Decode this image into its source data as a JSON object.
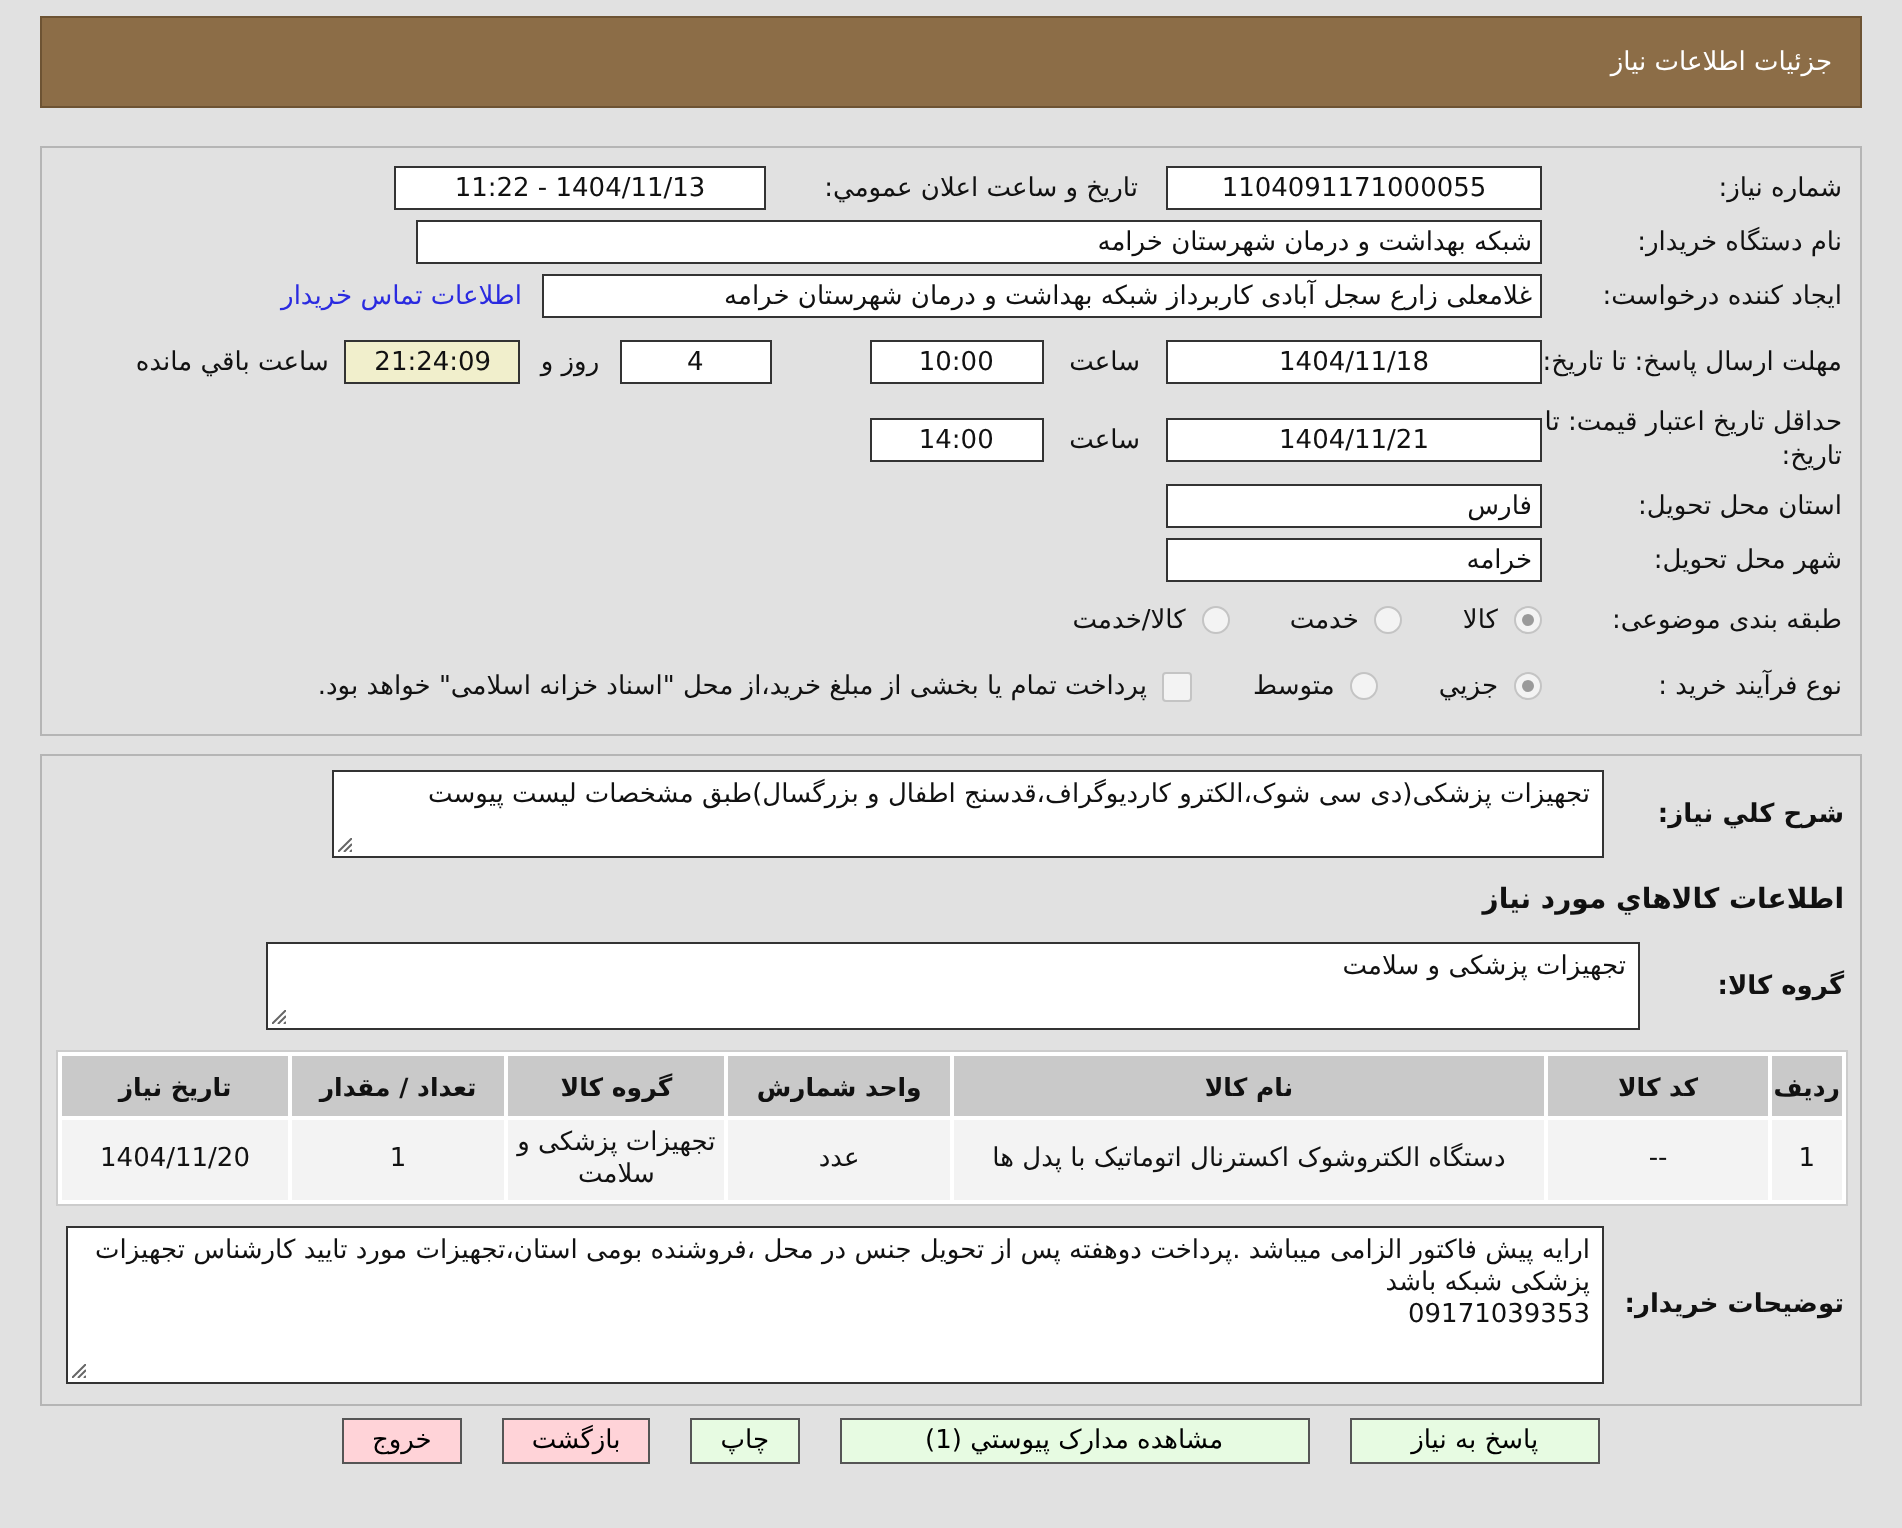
{
  "header": {
    "title": "جزئیات اطلاعات نیاز"
  },
  "summary": {
    "need_number": {
      "label": "شماره نیاز:",
      "value": "1104091171000055"
    },
    "announce": {
      "label": "تاریخ و ساعت اعلان عمومي:",
      "value": "1404/11/13 - 11:22"
    },
    "buyer_org": {
      "label": "نام دستگاه خریدار:",
      "value": "شبکه بهداشت و درمان شهرستان خرامه"
    },
    "requester": {
      "label": "ایجاد کننده درخواست:",
      "value": "غلامعلی زارع سجل آبادی کاربرداز شبکه بهداشت و درمان شهرستان خرامه",
      "link": "اطلاعات تماس خریدار"
    },
    "reply_deadline": {
      "label": "مهلت ارسال پاسخ: تا تاریخ:",
      "date": "1404/11/18",
      "time_label": "ساعت",
      "time": "10:00",
      "days": "4",
      "days_label": "روز و",
      "remaining": "21:24:09",
      "remaining_label": "ساعت باقي مانده"
    },
    "price_validity": {
      "label": "حداقل تاریخ اعتبار قیمت: تا تاریخ:",
      "date": "1404/11/21",
      "time_label": "ساعت",
      "time": "14:00"
    },
    "province": {
      "label": "استان محل تحویل:",
      "value": "فارس"
    },
    "city": {
      "label": "شهر محل تحویل:",
      "value": "خرامه"
    },
    "category": {
      "label": "طبقه بندی موضوعی:",
      "options": [
        {
          "label": "کالا",
          "selected": true
        },
        {
          "label": "خدمت",
          "selected": false
        },
        {
          "label": "کالا/خدمت",
          "selected": false
        }
      ]
    },
    "process": {
      "label": "نوع فرآیند خرید :",
      "options": [
        {
          "label": "جزيي",
          "selected": true
        },
        {
          "label": "متوسط",
          "selected": false
        }
      ],
      "treasury": {
        "checked": false,
        "text": "پرداخت تمام یا بخشی از مبلغ خرید،از محل \"اسناد خزانه اسلامی\" خواهد بود."
      }
    }
  },
  "details": {
    "description": {
      "label": "شرح کلي نیاز:",
      "value": "تجهیزات پزشکی(دی سی شوک،الکترو کاردیوگراف،قدسنج اطفال و بزرگسال)طبق مشخصات لیست پیوست"
    },
    "goods_heading": "اطلاعات کالاهاي مورد نیاز",
    "goods_group": {
      "label": "گروه کالا:",
      "value": "تجهیزات پزشکی و سلامت"
    },
    "table": {
      "columns": [
        "ردیف",
        "کد کالا",
        "نام کالا",
        "واحد شمارش",
        "گروه کالا",
        "تعداد / مقدار",
        "تاریخ نیاز"
      ],
      "rows": [
        [
          "1",
          "--",
          "دستگاه الکتروشوک اکسترنال اتوماتیک با پدل ها",
          "عدد",
          "تجهیزات پزشکی و سلامت",
          "1",
          "1404/11/20"
        ]
      ]
    },
    "buyer_notes": {
      "label": "توضیحات خریدار:",
      "lines": [
        "ارایه پیش فاکتور الزامی میباشد .پرداخت دوهفته پس از تحویل جنس در محل ،فروشنده بومی استان،تجهیزات مورد تایید کارشناس تجهیزات پزشکی شبکه باشد",
        "09171039353"
      ]
    }
  },
  "buttons": [
    {
      "label": "پاسخ به نیاز",
      "kind": "normal"
    },
    {
      "label": "مشاهده مدارک پیوستي (1)",
      "kind": "normal"
    },
    {
      "label": "چاپ",
      "kind": "normal"
    },
    {
      "label": "بازگشت",
      "kind": "danger"
    },
    {
      "label": "خروج",
      "kind": "danger"
    }
  ]
}
